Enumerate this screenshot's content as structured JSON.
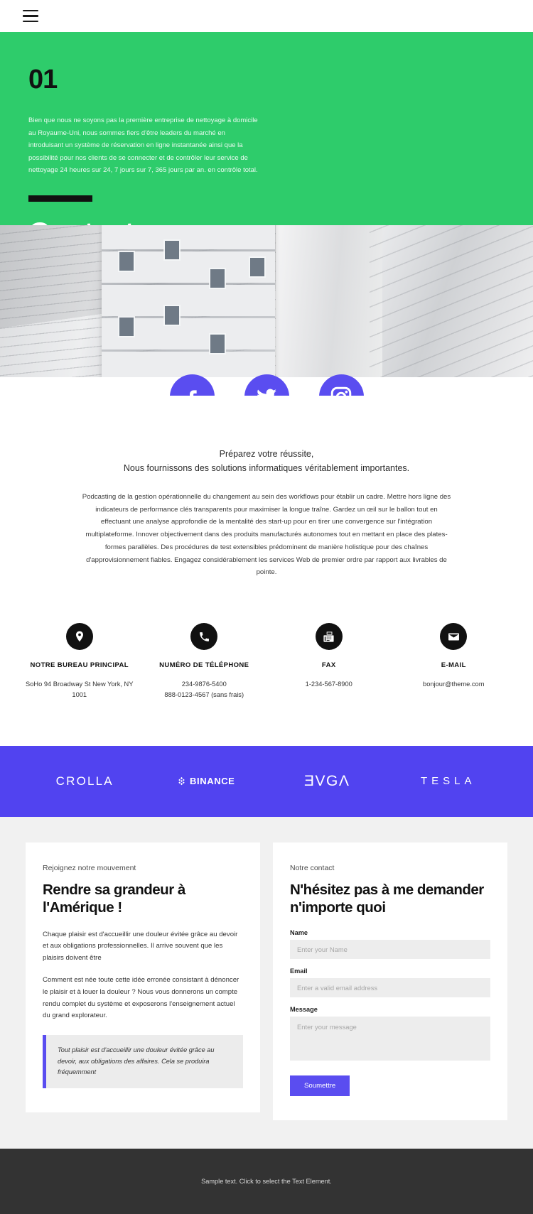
{
  "header": {
    "menu_icon": "hamburger-menu-icon"
  },
  "hero": {
    "number": "01",
    "description": "Bien que nous ne soyons pas la première entreprise de nettoyage à domicile au Royaume-Uni, nous sommes fiers d'être leaders du marché en introduisant un système de réservation en ligne instantanée ainsi que la possibilité pour nos clients de se connecter et de contrôler leur service de nettoyage 24 heures sur 24, 7 jours sur 7, 365 jours par an. en contrôle total.",
    "title": "Contactez-nous",
    "bg_color": "#2ecc6b"
  },
  "social": {
    "accent_color": "#5a4df0",
    "items": [
      {
        "name": "facebook-icon",
        "label": "Facebook"
      },
      {
        "name": "twitter-icon",
        "label": "Twitter"
      },
      {
        "name": "instagram-icon",
        "label": "Instagram"
      }
    ]
  },
  "intro": {
    "lead_line_1": "Préparez votre réussite,",
    "lead_line_2": "Nous fournissons des solutions informatiques véritablement importantes.",
    "body": "Podcasting de la gestion opérationnelle du changement au sein des workflows pour établir un cadre. Mettre hors ligne des indicateurs de performance clés transparents pour maximiser la longue traîne. Gardez un œil sur le ballon tout en effectuant une analyse approfondie de la mentalité des start-up pour en tirer une convergence sur l'intégration multiplateforme. Innover objectivement dans des produits manufacturés autonomes tout en mettant en place des plates-formes parallèles. Des procédures de test extensibles prédominent de manière holistique pour des chaînes d'approvisionnement fiables. Engagez considérablement les services Web de premier ordre par rapport aux livrables de pointe."
  },
  "contacts": [
    {
      "icon": "location-pin-icon",
      "label": "NOTRE BUREAU PRINCIPAL",
      "value": "SoHo 94 Broadway St New York, NY 1001"
    },
    {
      "icon": "phone-icon",
      "label": "NUMÉRO DE TÉLÉPHONE",
      "value": "234-9876-5400\n888-0123-4567 (sans frais)"
    },
    {
      "icon": "fax-icon",
      "label": "FAX",
      "value": "1-234-567-8900"
    },
    {
      "icon": "envelope-icon",
      "label": "E-MAIL",
      "value": "bonjour@theme.com"
    }
  ],
  "brands": {
    "bg_color": "#5143f0",
    "items": [
      {
        "name": "crolla-logo",
        "label": "CROLLA"
      },
      {
        "name": "binance-logo",
        "label": "BINANCE"
      },
      {
        "name": "evga-logo",
        "label": "ƎVGΛ"
      },
      {
        "name": "tesla-logo",
        "label": "TESLA"
      }
    ]
  },
  "left_card": {
    "kicker": "Rejoignez notre mouvement",
    "title": "Rendre sa grandeur à l'Amérique !",
    "paragraph_1": "Chaque plaisir est d'accueillir une douleur évitée grâce au devoir et aux obligations professionnelles. Il arrive souvent que les plaisirs doivent être",
    "paragraph_2": "Comment est née toute cette idée erronée consistant à dénoncer le plaisir et à louer la douleur ? Nous vous donnerons un compte rendu complet du système et exposerons l'enseignement actuel du grand explorateur.",
    "quote": "Tout plaisir est d'accueillir une douleur évitée grâce au devoir, aux obligations des affaires. Cela se produira fréquemment"
  },
  "form_card": {
    "kicker": "Notre contact",
    "title": "N'hésitez pas à me demander n'importe quoi",
    "name_label": "Name",
    "name_placeholder": "Enter your Name",
    "email_label": "Email",
    "email_placeholder": "Enter a valid email address",
    "message_label": "Message",
    "message_placeholder": "Enter your message",
    "submit_label": "Soumettre",
    "accent_color": "#5a4df0"
  },
  "footer": {
    "text": "Sample text. Click to select the Text Element.",
    "bg_color": "#333333"
  }
}
